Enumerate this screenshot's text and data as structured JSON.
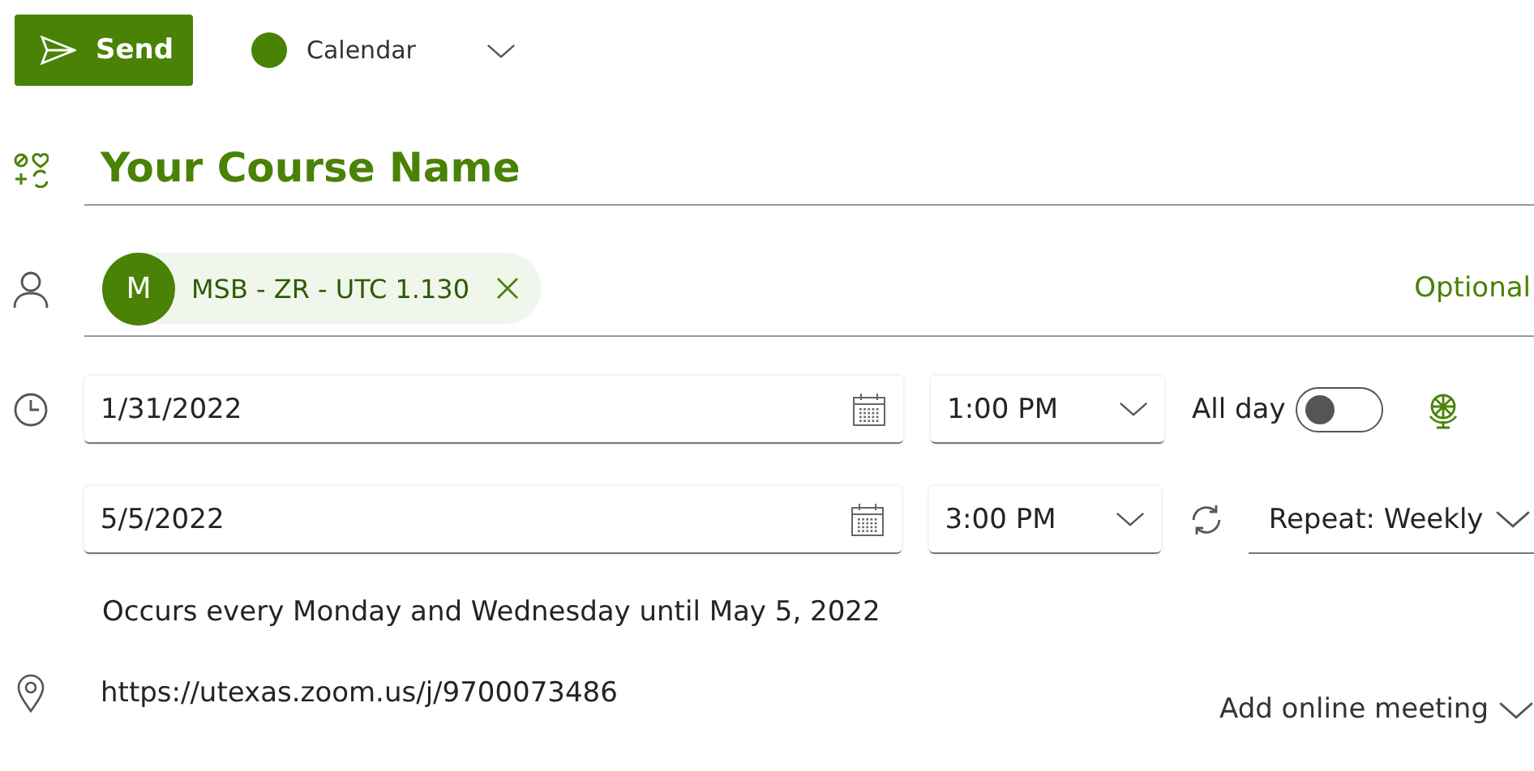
{
  "toolbar": {
    "send_label": "Send",
    "calendar": {
      "label": "Calendar",
      "color": "#498205"
    }
  },
  "title": "Your Course Name",
  "attendees": [
    {
      "initial": "M",
      "name": "MSB - ZR - UTC 1.130"
    }
  ],
  "optional_label": "Optional",
  "start": {
    "date": "1/31/2022",
    "time": "1:00 PM"
  },
  "all_day": {
    "label": "All day",
    "on": false
  },
  "end": {
    "date": "5/5/2022",
    "time": "3:00 PM"
  },
  "repeat": {
    "label": "Repeat:",
    "value": "Weekly"
  },
  "recurrence_note": "Occurs every Monday and Wednesday until May 5, 2022",
  "location": "https://utexas.zoom.us/j/9700073486",
  "online_meeting_label": "Add online meeting"
}
